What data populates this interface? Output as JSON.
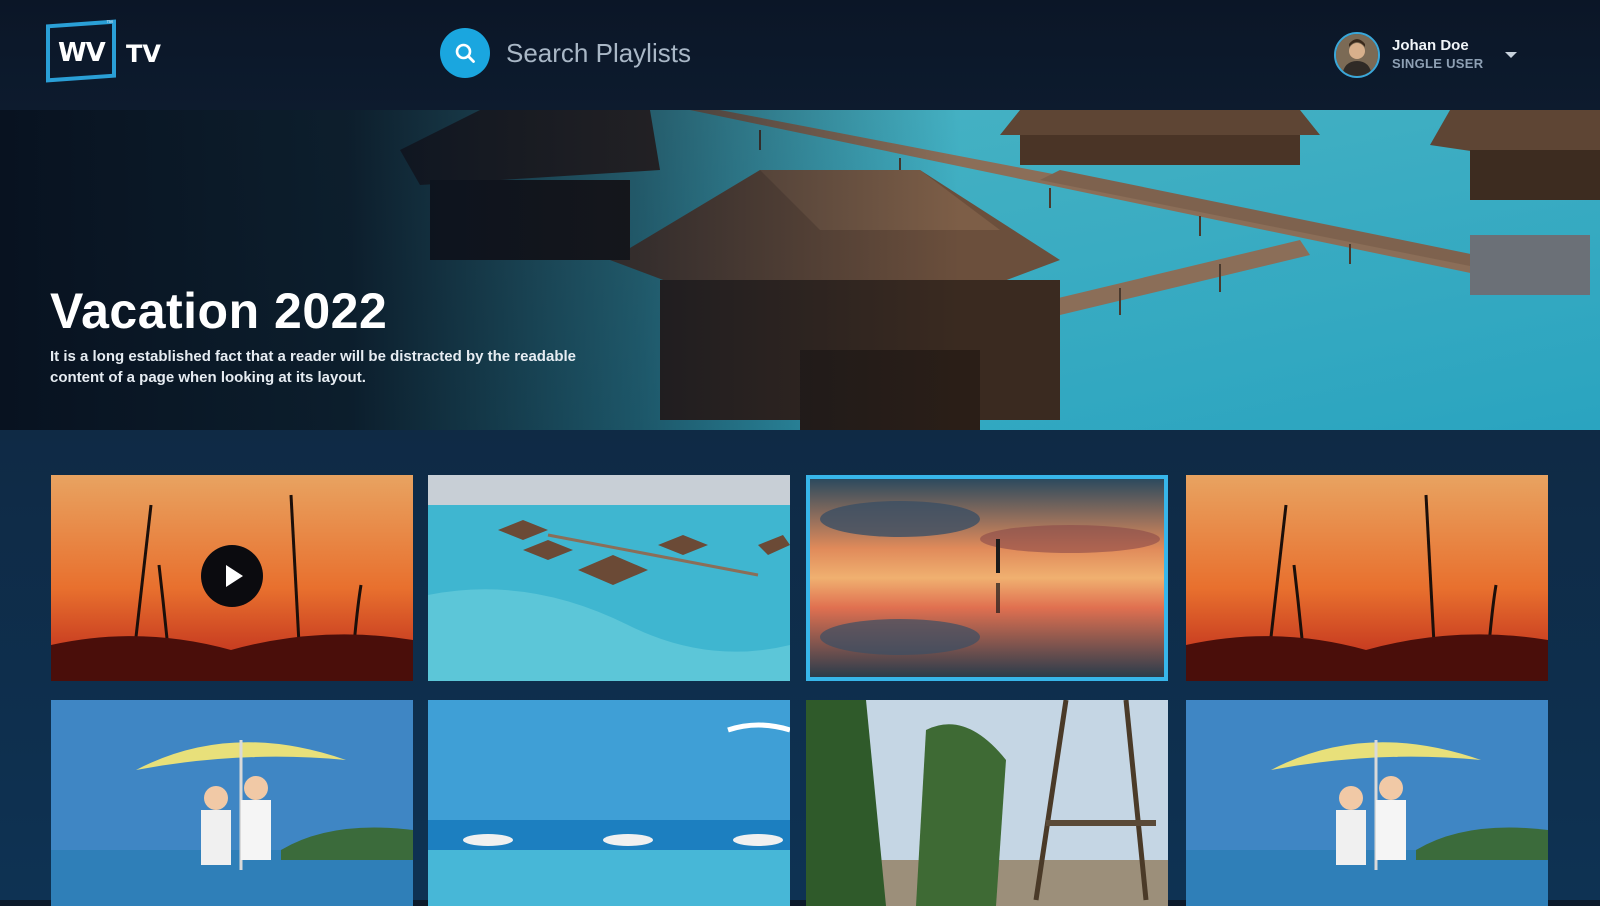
{
  "app": {
    "logo_main": "WV",
    "logo_suffix": "TV",
    "logo_mark": "™"
  },
  "search": {
    "placeholder": "Search Playlists",
    "icon": "search-icon"
  },
  "user": {
    "name": "Johan Doe",
    "role": "SINGLE USER",
    "caret_icon": "chevron-down-icon"
  },
  "hero": {
    "title": "Vacation 2022",
    "description": "It is a long established fact that a reader will be distracted by the readable content of a page when looking at its layout."
  },
  "playlist": {
    "tiles": [
      {
        "name": "sunset-grass",
        "has_play": true
      },
      {
        "name": "overwater-villas",
        "has_play": false
      },
      {
        "name": "reflection-sunset",
        "focused": true
      },
      {
        "name": "sunset-grass",
        "has_play": false
      },
      {
        "name": "kids-umbrella"
      },
      {
        "name": "resort-pool"
      },
      {
        "name": "palm-beach"
      },
      {
        "name": "kids-umbrella"
      }
    ]
  },
  "colors": {
    "accent": "#1aa6df",
    "focus": "#37b6ea",
    "background": "#0c1a2b"
  }
}
